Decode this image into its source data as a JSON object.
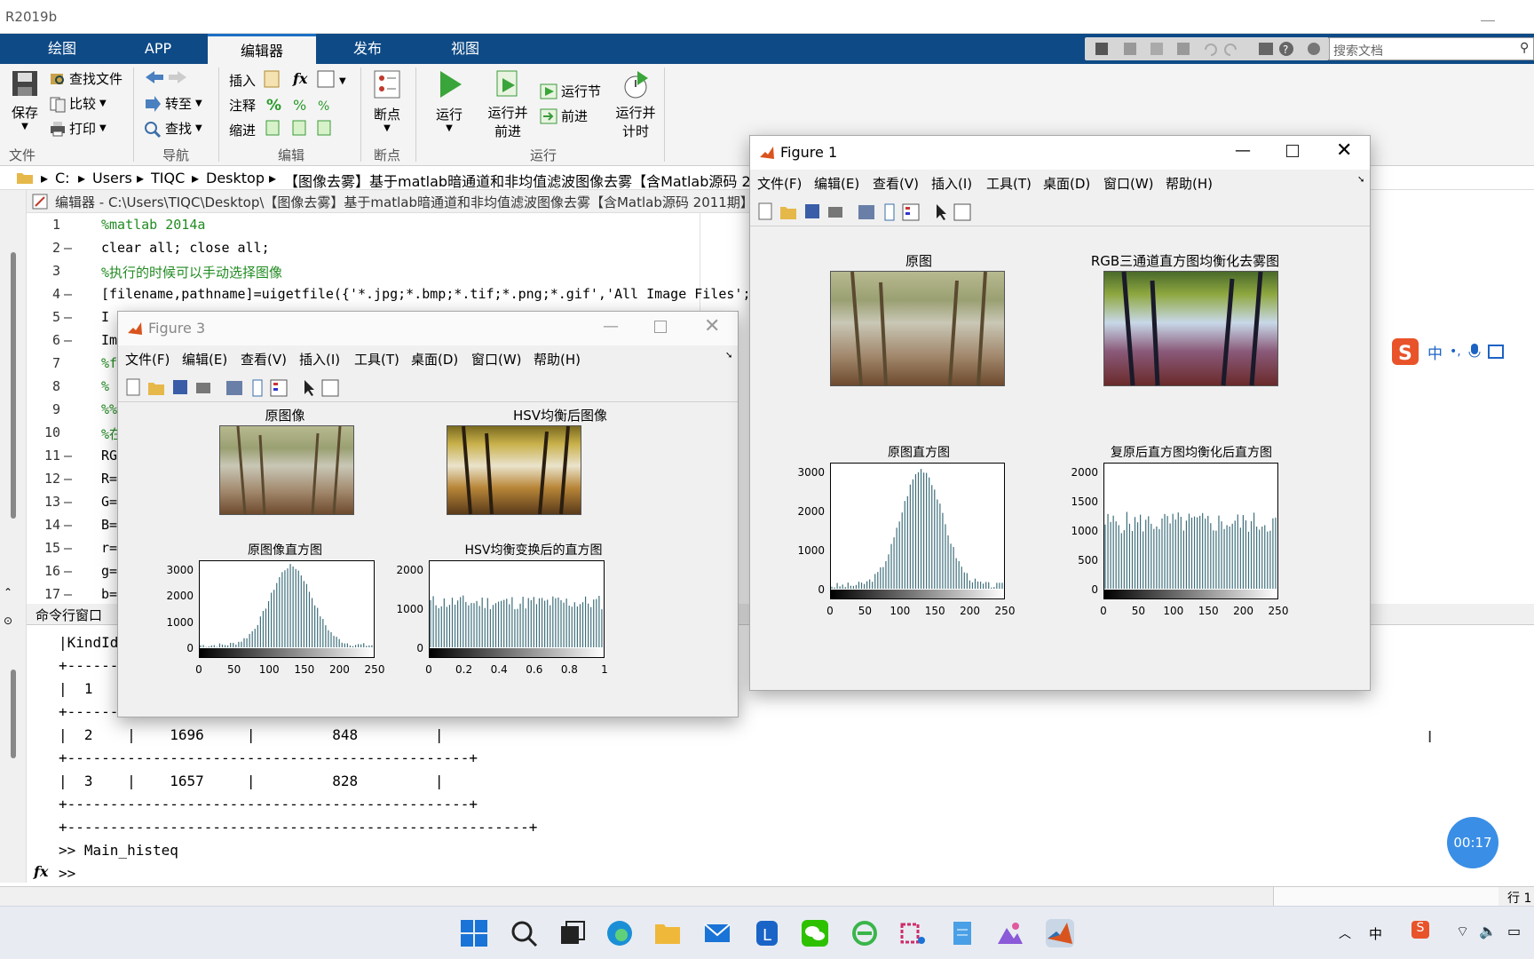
{
  "app": {
    "title": "R2019b"
  },
  "tabs": [
    {
      "label": "绘图"
    },
    {
      "label": "APP"
    },
    {
      "label": "编辑器"
    },
    {
      "label": "发布"
    },
    {
      "label": "视图"
    }
  ],
  "search": {
    "placeholder": "搜索文档"
  },
  "ribbon": {
    "file": {
      "save": "保存",
      "find_files": "查找文件",
      "compare": "比较",
      "print": "打印",
      "group": "文件"
    },
    "nav": {
      "goto": "转至",
      "find": "查找",
      "group": "导航"
    },
    "edit": {
      "insert": "插入",
      "fx": "fx",
      "comment": "注释",
      "indent": "缩进",
      "group": "编辑"
    },
    "breakpoints": {
      "label": "断点",
      "group": "断点"
    },
    "run": {
      "run": "运行",
      "run_advance_1": "运行并",
      "run_advance_2": "前进",
      "run_section": "运行节",
      "advance": "前进",
      "run_time_1": "运行并",
      "run_time_2": "计时",
      "group": "运行"
    }
  },
  "address": {
    "parts": [
      "C:",
      "Users",
      "TIQC",
      "Desktop",
      "【图像去雾】基于matlab暗通道和非均值滤波图像去雾【含Matlab源码 2011期"
    ]
  },
  "editor": {
    "title": "编辑器 - C:\\Users\\TIQC\\Desktop\\【图像去雾】基于matlab暗通道和非均值滤波图像去雾【含Matlab源码 2011期】\\",
    "lines": [
      {
        "n": "1",
        "d": "",
        "code": "%matlab 2014a"
      },
      {
        "n": "2",
        "d": "—",
        "code": "clear all; close all;"
      },
      {
        "n": "3",
        "d": "",
        "code": "%执行的时候可以手动选择图像"
      },
      {
        "n": "4",
        "d": "—",
        "code": "[filename,pathname]=uigetfile({'*.jpg;*.bmp;*.tif;*.png;*.gif','All Image Files';"
      },
      {
        "n": "5",
        "d": "—",
        "code": "I"
      },
      {
        "n": "6",
        "d": "—",
        "code": "Im"
      },
      {
        "n": "7",
        "d": "",
        "code": "%f"
      },
      {
        "n": "8",
        "d": "",
        "code": "%"
      },
      {
        "n": "9",
        "d": "",
        "code": "%%"
      },
      {
        "n": "10",
        "d": "",
        "code": "%在"
      },
      {
        "n": "11",
        "d": "—",
        "code": "RG"
      },
      {
        "n": "12",
        "d": "—",
        "code": "R="
      },
      {
        "n": "13",
        "d": "—",
        "code": "G="
      },
      {
        "n": "14",
        "d": "—",
        "code": "B="
      },
      {
        "n": "15",
        "d": "—",
        "code": "r="
      },
      {
        "n": "16",
        "d": "—",
        "code": "g="
      },
      {
        "n": "17",
        "d": "—",
        "code": "b="
      }
    ]
  },
  "command_window": {
    "title": "命令行窗口",
    "lines": [
      "|KindId",
      "+-------",
      "|  1",
      "+-------",
      "|  2    |    1696     |         848         |",
      "+-----------------------------------------------+",
      "|  3    |    1657     |         828         |",
      "+-----------------------------------------------+",
      "+------------------------------------------------------+",
      ">> Main_histeq",
      ">>"
    ],
    "fx": "fx"
  },
  "figure3": {
    "title": "Figure 3",
    "menu": [
      "文件(F)",
      "编辑(E)",
      "查看(V)",
      "插入(I)",
      "工具(T)",
      "桌面(D)",
      "窗口(W)",
      "帮助(H)"
    ],
    "img1_title": "原图像",
    "img2_title": "HSV均衡后图像",
    "hist1_title": "原图像直方图",
    "hist2_title": "HSV均衡变换后的直方图",
    "hist1_yticks": [
      "3000",
      "2000",
      "1000",
      "0"
    ],
    "hist1_xticks": [
      "0",
      "50",
      "100",
      "150",
      "200",
      "250"
    ],
    "hist2_yticks": [
      "2000",
      "1000",
      "0"
    ],
    "hist2_xticks": [
      "0",
      "0.2",
      "0.4",
      "0.6",
      "0.8",
      "1"
    ]
  },
  "figure1": {
    "title": "Figure 1",
    "menu": [
      "文件(F)",
      "编辑(E)",
      "查看(V)",
      "插入(I)",
      "工具(T)",
      "桌面(D)",
      "窗口(W)",
      "帮助(H)"
    ],
    "img1_title": "原图",
    "img2_title": "RGB三通道直方图均衡化去雾图",
    "hist1_title": "原图直方图",
    "hist2_title": "复原后直方图均衡化后直方图",
    "hist1_yticks": [
      "3000",
      "2000",
      "1000",
      "0"
    ],
    "hist1_xticks": [
      "0",
      "50",
      "100",
      "150",
      "200",
      "250"
    ],
    "hist2_yticks": [
      "2000",
      "1500",
      "1000",
      "500",
      "0"
    ],
    "hist2_xticks": [
      "0",
      "50",
      "100",
      "150",
      "200",
      "250"
    ]
  },
  "ime": {
    "chinese": "中"
  },
  "timer": {
    "label": "00:17"
  },
  "statusbar": {
    "position": "行 1"
  },
  "taskbar": {
    "icons": [
      "windows-start",
      "search",
      "task-view",
      "edge",
      "file-explorer",
      "mail",
      "lightning",
      "wechat",
      "ie",
      "snip",
      "notepad",
      "photos",
      "matlab"
    ],
    "tray_lang": "中"
  }
}
